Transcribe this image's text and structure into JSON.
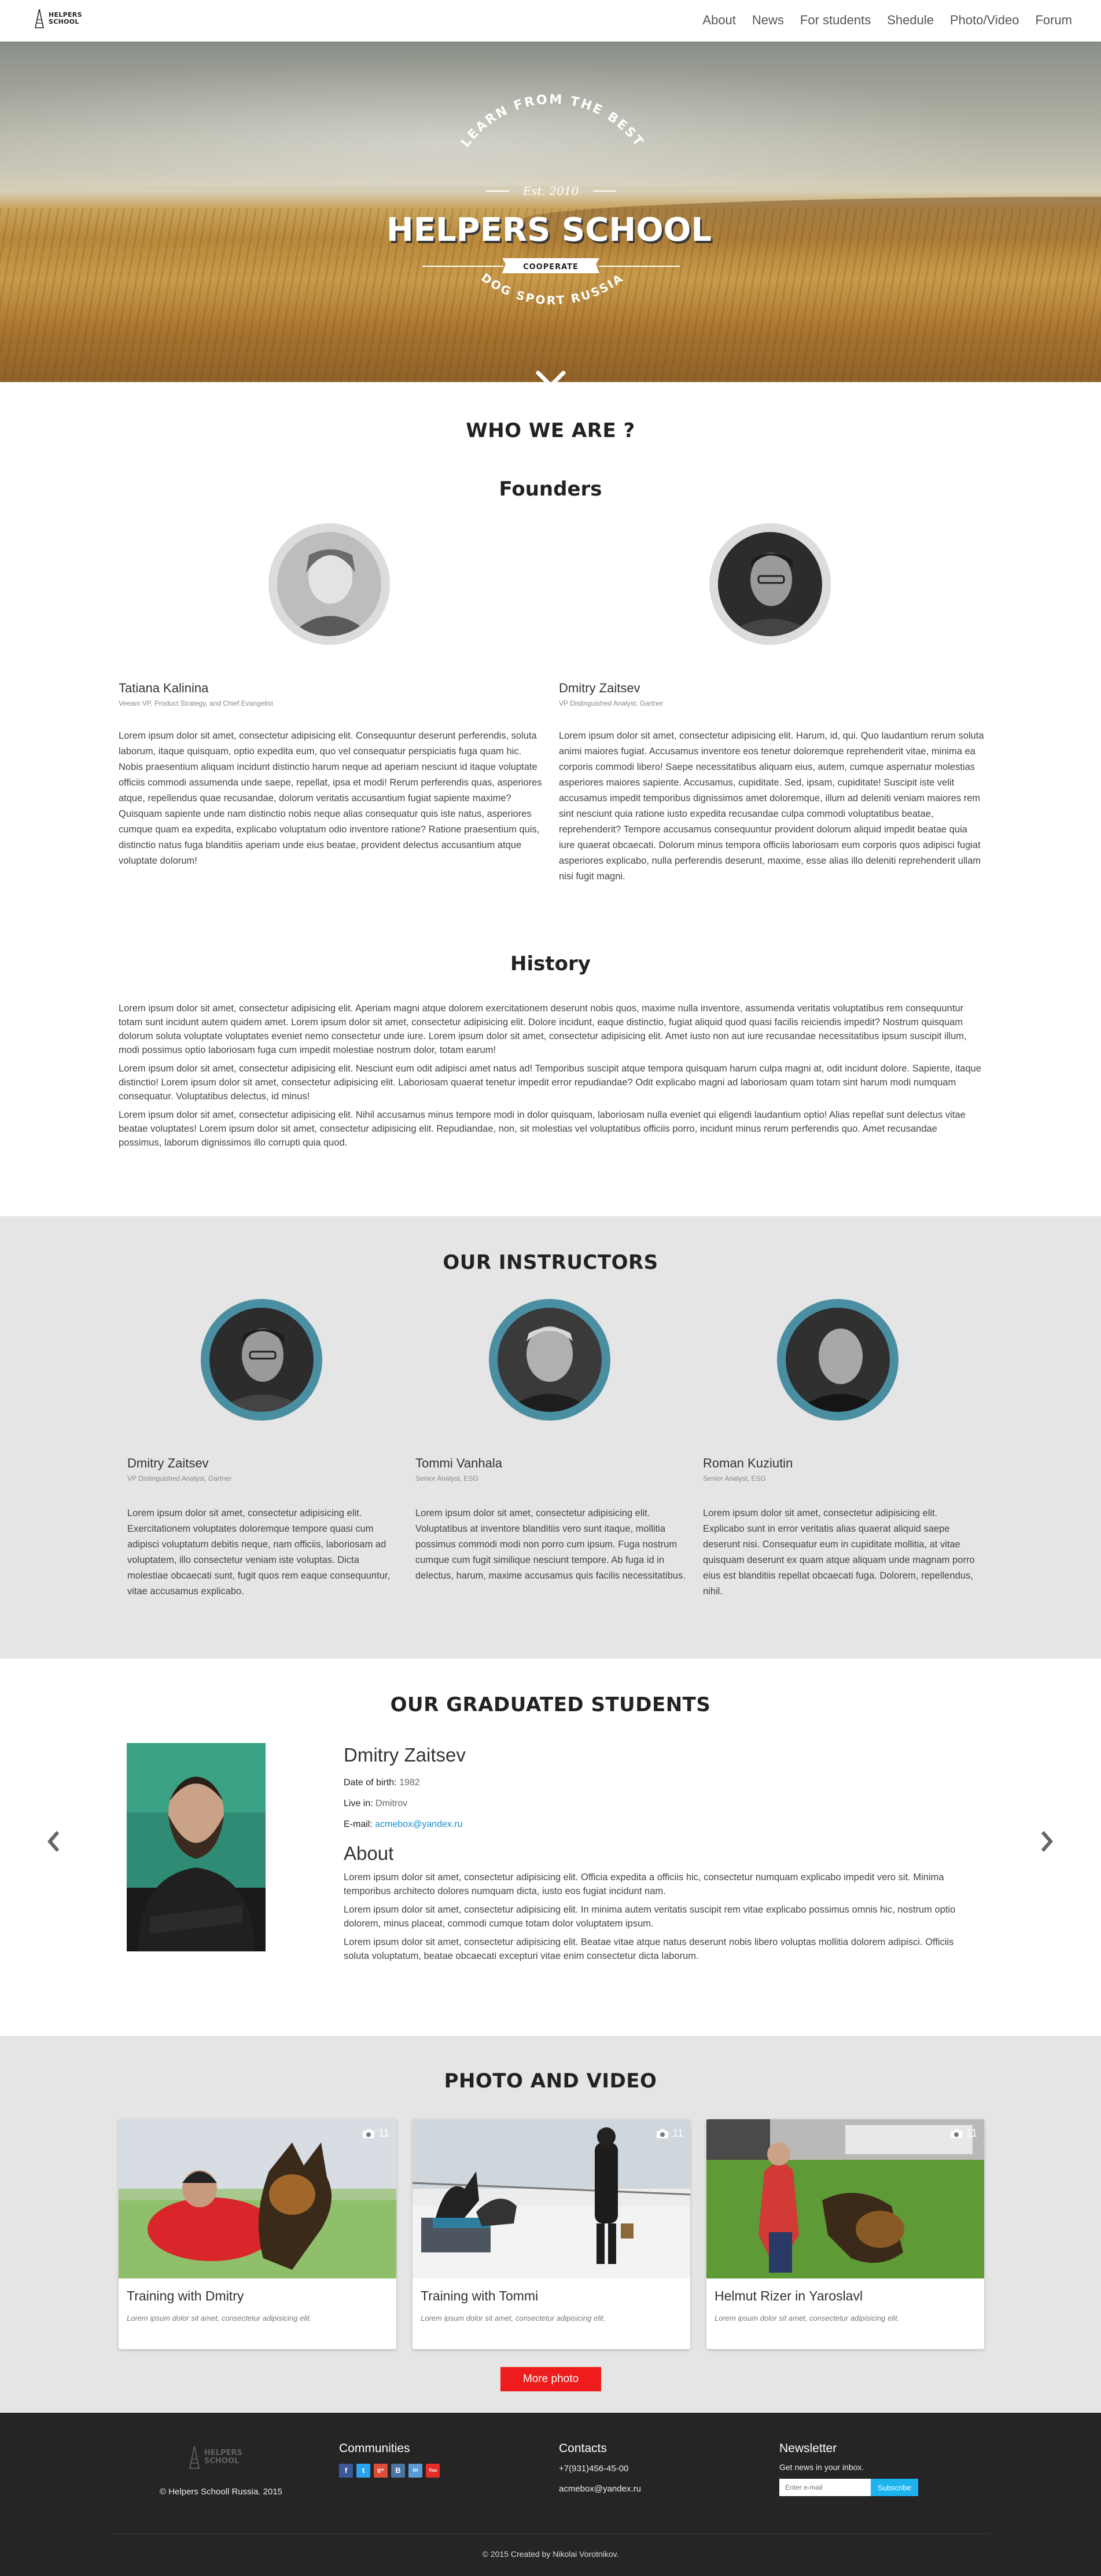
{
  "brand": {
    "line1": "HELPERS",
    "line2": "SCHOOL"
  },
  "nav": {
    "items": [
      "About",
      "News",
      "For students",
      "Shedule",
      "Photo/Video",
      "Forum"
    ]
  },
  "hero": {
    "top_arc": "LEARN FROM THE BEST",
    "est": "Est. 2010",
    "title": "HELPERS SCHOOL",
    "ribbon": "COOPERATE",
    "bottom_arc": "DOG SPORT RUSSIA"
  },
  "who": {
    "heading": "WHO WE ARE ?",
    "founders_heading": "Founders",
    "founders": [
      {
        "name": "Tatiana Kalinina",
        "role": "Veeam VP, Product Strategy, and Chief Evangelist",
        "bio": "Lorem ipsum dolor sit amet, consectetur adipisicing elit. Consequuntur deserunt perferendis, soluta laborum, itaque quisquam, optio expedita eum, quo vel consequatur perspiciatis fuga quam hic. Nobis praesentium aliquam incidunt distinctio harum neque ad aperiam nesciunt id itaque voluptate officiis commodi assumenda unde saepe, repellat, ipsa et modi! Rerum perferendis quas, asperiores atque, repellendus quae recusandae, dolorum veritatis accusantium fugiat sapiente maxime? Quisquam sapiente unde nam distinctio nobis neque alias consequatur quis iste natus, asperiores cumque quam ea expedita, explicabo voluptatum odio inventore ratione? Ratione praesentium quis, distinctio natus fuga blanditiis aperiam unde eius beatae, provident delectus accusantium atque voluptate dolorum!"
      },
      {
        "name": "Dmitry Zaitsev",
        "role": "VP Distinguished Analyst, Gartner",
        "bio": "Lorem ipsum dolor sit amet, consectetur adipisicing elit. Harum, id, qui. Quo laudantium rerum soluta animi maiores fugiat. Accusamus inventore eos tenetur doloremque reprehenderit vitae, minima ea corporis commodi libero! Saepe necessitatibus aliquam eius, autem, cumque aspernatur molestias asperiores maiores sapiente. Accusamus, cupiditate. Sed, ipsam, cupiditate! Suscipit iste velit accusamus impedit temporibus dignissimos amet doloremque, illum ad deleniti veniam maiores rem sint nesciunt quia ratione iusto expedita recusandae culpa commodi voluptatibus beatae, reprehenderit? Tempore accusamus consequuntur provident dolorum aliquid impedit beatae quia iure quaerat obcaecati. Dolorum minus tempora officiis laboriosam eum corporis quos adipisci fugiat asperiores explicabo, nulla perferendis deserunt, maxime, esse alias illo deleniti reprehenderit ullam nisi fugit magni."
      }
    ],
    "history_heading": "History",
    "history": [
      "Lorem ipsum dolor sit amet, consectetur adipisicing elit. Aperiam magni atque dolorem exercitationem deserunt nobis quos, maxime nulla inventore, assumenda veritatis voluptatibus rem consequuntur totam sunt incidunt autem quidem amet. Lorem ipsum dolor sit amet, consectetur adipisicing elit. Dolore incidunt, eaque distinctio, fugiat aliquid quod quasi facilis reiciendis impedit? Nostrum quisquam dolorum soluta voluptate voluptates eveniet nemo consectetur unde iure. Lorem ipsum dolor sit amet, consectetur adipisicing elit. Amet iusto non aut iure recusandae necessitatibus ipsum suscipit illum, modi possimus optio laboriosam fuga cum impedit molestiae nostrum dolor, totam earum!",
      "Lorem ipsum dolor sit amet, consectetur adipisicing elit. Nesciunt eum odit adipisci amet natus ad! Temporibus suscipit atque tempora quisquam harum culpa magni at, odit incidunt dolore. Sapiente, itaque distinctio! Lorem ipsum dolor sit amet, consectetur adipisicing elit. Laboriosam quaerat tenetur impedit error repudiandae? Odit explicabo magni ad laboriosam quam totam sint harum modi numquam consequatur. Voluptatibus delectus, id minus!",
      "Lorem ipsum dolor sit amet, consectetur adipisicing elit. Nihil accusamus minus tempore modi in dolor quisquam, laboriosam nulla eveniet qui eligendi laudantium optio! Alias repellat sunt delectus vitae beatae voluptates! Lorem ipsum dolor sit amet, consectetur adipisicing elit. Repudiandae, non, sit molestias vel voluptatibus officiis porro, incidunt minus rerum perferendis quo. Amet recusandae possimus, laborum dignissimos illo corrupti quia quod."
    ]
  },
  "instructors": {
    "heading": "OUR INSTRUCTORS",
    "items": [
      {
        "name": "Dmitry Zaitsev",
        "role": "VP Distinguished Analyst, Gartner",
        "bio": "Lorem ipsum dolor sit amet, consectetur adipisicing elit. Exercitationem voluptates doloremque tempore quasi cum adipisci voluptatum debitis neque, nam officiis, laboriosam ad voluptatem, illo consectetur veniam iste voluptas. Dicta molestiae obcaecati sunt, fugit quos rem eaque consequuntur, vitae accusamus explicabo."
      },
      {
        "name": "Tommi Vanhala",
        "role": "Senior Analyst, ESG",
        "bio": "Lorem ipsum dolor sit amet, consectetur adipisicing elit. Voluptatibus at inventore blanditiis vero sunt itaque, mollitia possimus commodi modi non porro cum ipsum. Fuga nostrum cumque cum fugit similique nesciunt tempore. Ab fuga id in delectus, harum, maxime accusamus quis facilis necessitatibus."
      },
      {
        "name": "Roman Kuziutin",
        "role": "Senior Analyst, ESG",
        "bio": "Lorem ipsum dolor sit amet, consectetur adipisicing elit. Explicabo sunt in error veritatis alias quaerat aliquid saepe deserunt nisi. Consequatur eum in cupiditate mollitia, at vitae quisquam deserunt ex quam atque aliquam unde magnam porro eius est blanditiis repellat obcaecati fuga. Dolorem, repellendus, nihil."
      }
    ]
  },
  "students": {
    "heading": "OUR GRADUATED STUDENTS",
    "name": "Dmitry Zaitsev",
    "dob_label": "Date of birth:",
    "dob": "1982",
    "live_label": "Live in:",
    "live": "Dmitrov",
    "email_label": "E-mail:",
    "email": "acmebox@yandex.ru",
    "about_heading": "About",
    "about": [
      "Lorem ipsum dolor sit amet, consectetur adipisicing elit. Officia expedita a officiis hic, consectetur numquam explicabo impedit vero sit. Minima temporibus architecto dolores numquam dicta, iusto eos fugiat incidunt nam.",
      "Lorem ipsum dolor sit amet, consectetur adipisicing elit. In minima autem veritatis suscipit rem vitae explicabo possimus omnis hic, nostrum optio dolorem, minus placeat, commodi cumque totam dolor voluptatem ipsum.",
      "Lorem ipsum dolor sit amet, consectetur adipisicing elit. Beatae vitae atque natus deserunt nobis libero voluptas mollitia dolorem adipisci. Officiis soluta voluptatum, beatae obcaecati excepturi vitae enim consectetur dicta laborum."
    ],
    "prev_icon": "chevron-left-icon",
    "next_icon": "chevron-right-icon"
  },
  "media": {
    "heading": "PHOTO AND VIDEO",
    "cards": [
      {
        "title": "Training with Dmitry",
        "desc": "Lorem ipsum dolor sit amet, consectetur adipisicing elit.",
        "count": "11"
      },
      {
        "title": "Training with Tommi",
        "desc": "Lorem ipsum dolor sit amet, consectetur adipisicing elit.",
        "count": "11"
      },
      {
        "title": "Helmut Rizer in Yaroslavl",
        "desc": "Lorem ipsum dolor sit amet, consectetur adipisicing elit.",
        "count": "11"
      }
    ],
    "more_label": "More photo"
  },
  "footer": {
    "copyright": "© Helpers Schooll Russia. 2015",
    "communities_heading": "Communities",
    "contacts_heading": "Contacts",
    "phone": "+7(931)456-45-00",
    "email": "acmebox@yandex.ru",
    "newsletter_heading": "Newsletter",
    "newsletter_text": "Get news in your inbox.",
    "email_placeholder": "Enter e-mail",
    "subscribe_label": "Subscribe",
    "credit": "© 2015 Created by Nikolai Vorotnikov.",
    "social": [
      "f",
      "t",
      "g+",
      "B",
      "in",
      "You"
    ]
  },
  "colors": {
    "accent_red": "#ee1c1c",
    "teal_ring": "#4a8fa1",
    "subscribe_blue": "#1cb3ef",
    "footer_bg": "#252525",
    "section_gray": "#e5e5e5"
  }
}
